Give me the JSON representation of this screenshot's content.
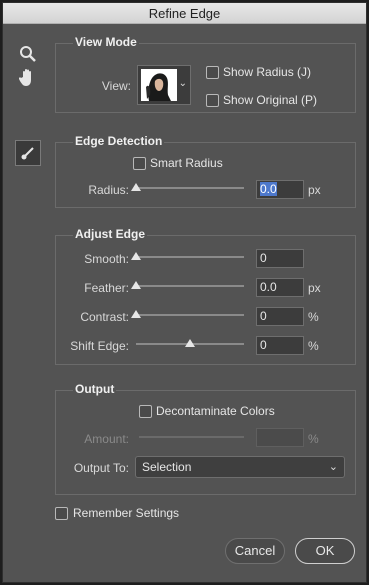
{
  "window": {
    "title": "Refine Edge"
  },
  "tools": {
    "zoom": "zoom-icon",
    "hand": "hand-icon",
    "refine_brush": "refine-radius-brush-icon"
  },
  "view_mode": {
    "title": "View Mode",
    "view_label": "View:",
    "show_radius": {
      "label": "Show Radius (J)",
      "checked": false
    },
    "show_original": {
      "label": "Show Original (P)",
      "checked": false
    }
  },
  "edge_detection": {
    "title": "Edge Detection",
    "smart_radius": {
      "label": "Smart Radius",
      "checked": false
    },
    "radius": {
      "label": "Radius:",
      "value": "0.0",
      "unit": "px",
      "slider_fraction": 0
    }
  },
  "adjust_edge": {
    "title": "Adjust Edge",
    "smooth": {
      "label": "Smooth:",
      "value": "0",
      "unit": "",
      "slider_fraction": 0
    },
    "feather": {
      "label": "Feather:",
      "value": "0.0",
      "unit": "px",
      "slider_fraction": 0
    },
    "contrast": {
      "label": "Contrast:",
      "value": "0",
      "unit": "%",
      "slider_fraction": 0
    },
    "shift_edge": {
      "label": "Shift Edge:",
      "value": "0",
      "unit": "%",
      "slider_fraction": 0.5
    }
  },
  "output": {
    "title": "Output",
    "decontaminate": {
      "label": "Decontaminate Colors",
      "checked": false
    },
    "amount": {
      "label": "Amount:",
      "value": "",
      "unit": "%",
      "enabled": false
    },
    "output_to_label": "Output To:",
    "output_to_value": "Selection"
  },
  "remember_settings": {
    "label": "Remember Settings",
    "checked": false
  },
  "buttons": {
    "cancel": "Cancel",
    "ok": "OK"
  }
}
